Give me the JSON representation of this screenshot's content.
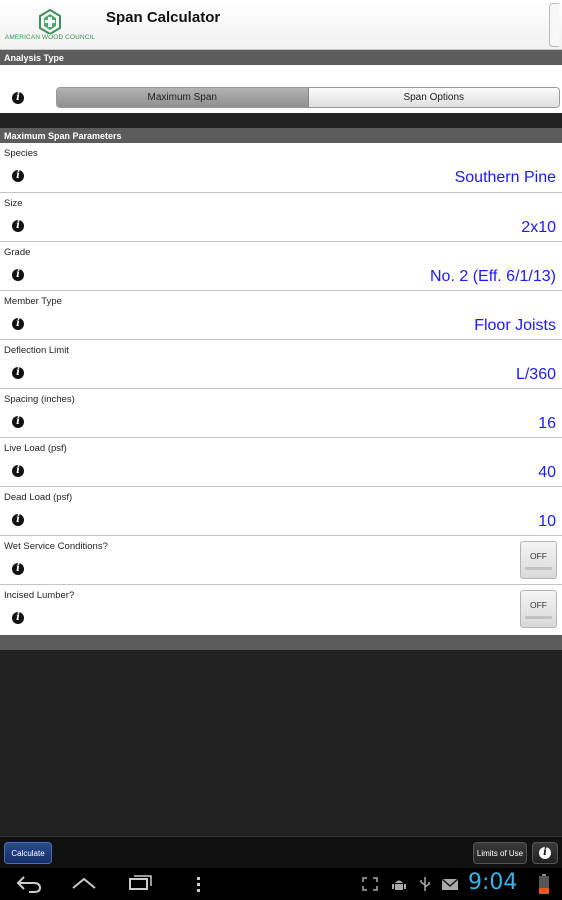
{
  "header": {
    "title": "Span Calculator",
    "logo_text": "AMERICAN WOOD COUNCIL"
  },
  "analysis_type": {
    "section_title": "Analysis Type",
    "tabs": [
      {
        "label": "Maximum Span",
        "selected": true
      },
      {
        "label": "Span Options",
        "selected": false
      }
    ]
  },
  "parameters": {
    "section_title": "Maximum Span Parameters",
    "rows": [
      {
        "label": "Species",
        "value": "Southern Pine"
      },
      {
        "label": "Size",
        "value": "2x10"
      },
      {
        "label": "Grade",
        "value": "No. 2 (Eff. 6/1/13)"
      },
      {
        "label": "Member Type",
        "value": "Floor Joists"
      },
      {
        "label": "Deflection Limit",
        "value": "L/360"
      },
      {
        "label": "Spacing (inches)",
        "value": "16"
      },
      {
        "label": "Live Load (psf)",
        "value": "40"
      },
      {
        "label": "Dead Load (psf)",
        "value": "10"
      },
      {
        "label": "Wet Service Conditions?",
        "toggle": "OFF"
      },
      {
        "label": "Incised Lumber?",
        "toggle": "OFF"
      }
    ]
  },
  "action_bar": {
    "calculate": "Calculate",
    "limits": "Limits of Use",
    "info_icon": "i"
  },
  "status_bar": {
    "time": "9:04"
  },
  "icons": {
    "info": "info-icon",
    "back": "back-icon",
    "home": "home-icon",
    "recents": "recents-icon",
    "menu": "menu-icon",
    "usb": "usb-icon",
    "debug": "android-debug-icon",
    "gmail": "gmail-icon",
    "screenshot": "screenshot-icon",
    "battery": "battery-icon"
  },
  "colors": {
    "value_text": "#1a1aff",
    "section_bar": "#5c5c5c",
    "clock": "#36b3e8",
    "calculate_button": "#1f3c7a"
  }
}
